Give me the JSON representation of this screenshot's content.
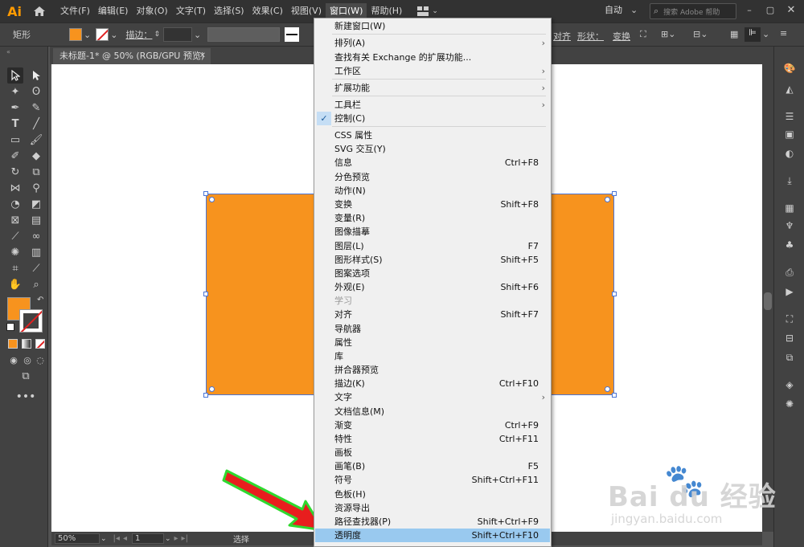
{
  "app": {
    "logo": "Ai"
  },
  "menubar": {
    "items": [
      "文件(F)",
      "编辑(E)",
      "对象(O)",
      "文字(T)",
      "选择(S)",
      "效果(C)",
      "视图(V)",
      "窗口(W)",
      "帮助(H)"
    ],
    "workspace": "自动",
    "search_placeholder": "搜索 Adobe 帮助"
  },
  "controlbar": {
    "object_type": "矩形",
    "stroke_label": "描边：",
    "align_label": "对齐",
    "shape_label": "形状：",
    "transform_label": "变换",
    "fill_color": "#f7931e"
  },
  "document": {
    "tab_title": "未标题-1* @ 50% (RGB/GPU 预览)",
    "rect_color": "#f7931e"
  },
  "statusbar": {
    "zoom": "50%",
    "artboard": "1",
    "mode": "选择"
  },
  "window_menu": {
    "items": [
      {
        "label": "新建窗口(W)",
        "shortcut": "",
        "submenu": false
      },
      {
        "label": "排列(A)",
        "shortcut": "",
        "submenu": true
      },
      {
        "label": "查找有关 Exchange 的扩展功能...",
        "shortcut": "",
        "submenu": false
      },
      {
        "label": "工作区",
        "shortcut": "",
        "submenu": true
      },
      {
        "label": "扩展功能",
        "shortcut": "",
        "submenu": true
      },
      {
        "label": "工具栏",
        "shortcut": "",
        "submenu": true
      },
      {
        "label": "控制(C)",
        "shortcut": "",
        "submenu": false,
        "checked": true
      },
      {
        "label": "CSS 属性",
        "shortcut": ""
      },
      {
        "label": "SVG 交互(Y)",
        "shortcut": ""
      },
      {
        "label": "信息",
        "shortcut": "Ctrl+F8"
      },
      {
        "label": "分色预览",
        "shortcut": ""
      },
      {
        "label": "动作(N)",
        "shortcut": ""
      },
      {
        "label": "变换",
        "shortcut": "Shift+F8"
      },
      {
        "label": "变量(R)",
        "shortcut": ""
      },
      {
        "label": "图像描摹",
        "shortcut": ""
      },
      {
        "label": "图层(L)",
        "shortcut": "F7"
      },
      {
        "label": "图形样式(S)",
        "shortcut": "Shift+F5"
      },
      {
        "label": "图案选项",
        "shortcut": ""
      },
      {
        "label": "外观(E)",
        "shortcut": "Shift+F6"
      },
      {
        "label": "学习",
        "shortcut": "",
        "disabled": true
      },
      {
        "label": "对齐",
        "shortcut": "Shift+F7"
      },
      {
        "label": "导航器",
        "shortcut": ""
      },
      {
        "label": "属性",
        "shortcut": ""
      },
      {
        "label": "库",
        "shortcut": ""
      },
      {
        "label": "拼合器预览",
        "shortcut": ""
      },
      {
        "label": "描边(K)",
        "shortcut": "Ctrl+F10"
      },
      {
        "label": "文字",
        "shortcut": "",
        "submenu": true
      },
      {
        "label": "文档信息(M)",
        "shortcut": ""
      },
      {
        "label": "渐变",
        "shortcut": "Ctrl+F9"
      },
      {
        "label": "特性",
        "shortcut": "Ctrl+F11"
      },
      {
        "label": "画板",
        "shortcut": ""
      },
      {
        "label": "画笔(B)",
        "shortcut": "F5"
      },
      {
        "label": "符号",
        "shortcut": "Shift+Ctrl+F11"
      },
      {
        "label": "色板(H)",
        "shortcut": ""
      },
      {
        "label": "资源导出",
        "shortcut": ""
      },
      {
        "label": "路径查找器(P)",
        "shortcut": "Shift+Ctrl+F9"
      },
      {
        "label": "透明度",
        "shortcut": "Shift+Ctrl+F10",
        "highlighted": true
      }
    ]
  },
  "watermark": {
    "brand": "Bai du 经验",
    "url": "jingyan.baidu.com"
  }
}
